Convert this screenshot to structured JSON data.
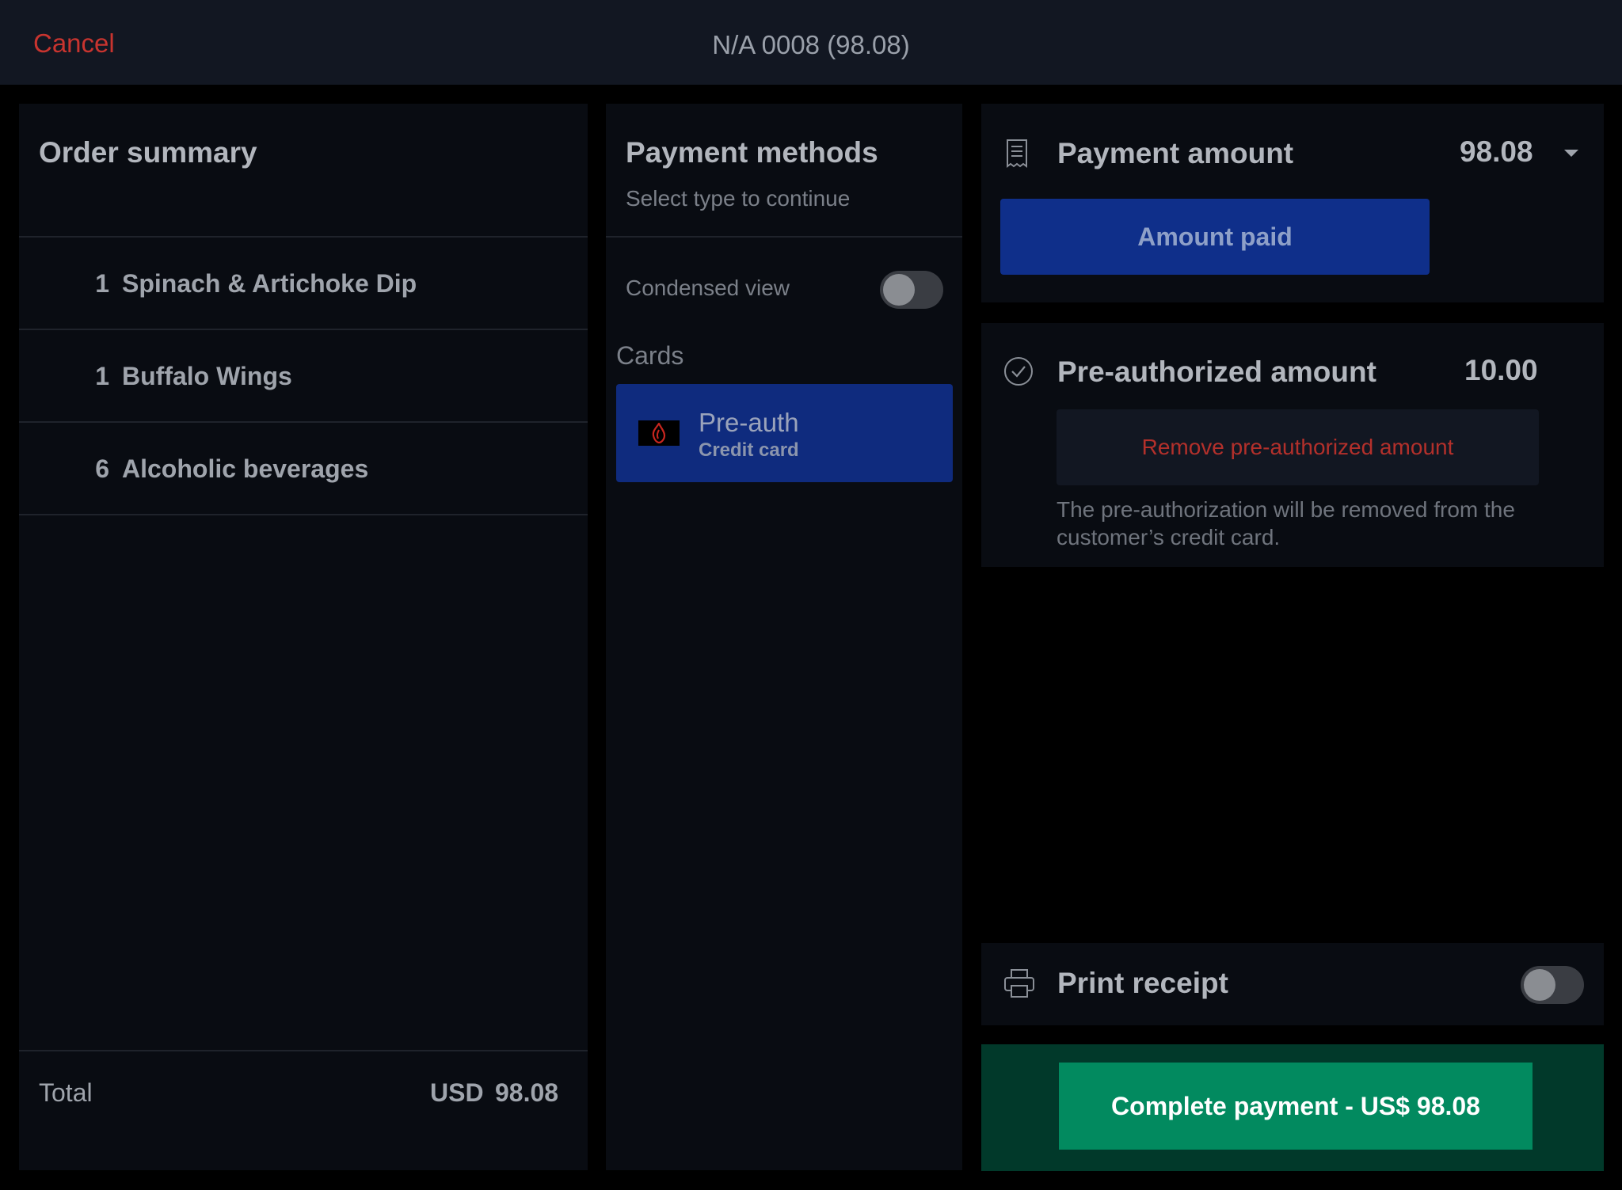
{
  "header": {
    "cancel_label": "Cancel",
    "title": "N/A 0008 (98.08)"
  },
  "order_summary": {
    "title": "Order summary",
    "items": [
      {
        "qty": "1",
        "name": "Spinach & Artichoke Dip"
      },
      {
        "qty": "1",
        "name": "Buffalo Wings"
      },
      {
        "qty": "6",
        "name": "Alcoholic beverages"
      }
    ],
    "total_label": "Total",
    "total_currency": "USD",
    "total_value": "98.08"
  },
  "payment_methods": {
    "title": "Payment methods",
    "subtitle": "Select type to continue",
    "condensed_label": "Condensed view",
    "condensed_on": false,
    "section_cards": "Cards",
    "selected_method": {
      "title": "Pre-auth",
      "subtitle": "Credit card",
      "icon": "lightspeed-flame-icon"
    }
  },
  "payment_amount": {
    "label": "Payment amount",
    "value": "98.08",
    "icon": "receipt-icon",
    "amount_paid_label": "Amount paid"
  },
  "preauth": {
    "label": "Pre-authorized amount",
    "value": "10.00",
    "icon": "check-circle-icon",
    "remove_label": "Remove pre-authorized amount",
    "note": "The pre-authorization will be removed from the customer’s credit card."
  },
  "receipt": {
    "label": "Print receipt",
    "icon": "printer-icon",
    "enabled": false
  },
  "complete": {
    "label": "Complete payment - US$ 98.08"
  },
  "colors": {
    "accent_blue": "#0f2f8a",
    "danger_red": "#c8342f",
    "success_green": "#028a5f"
  }
}
